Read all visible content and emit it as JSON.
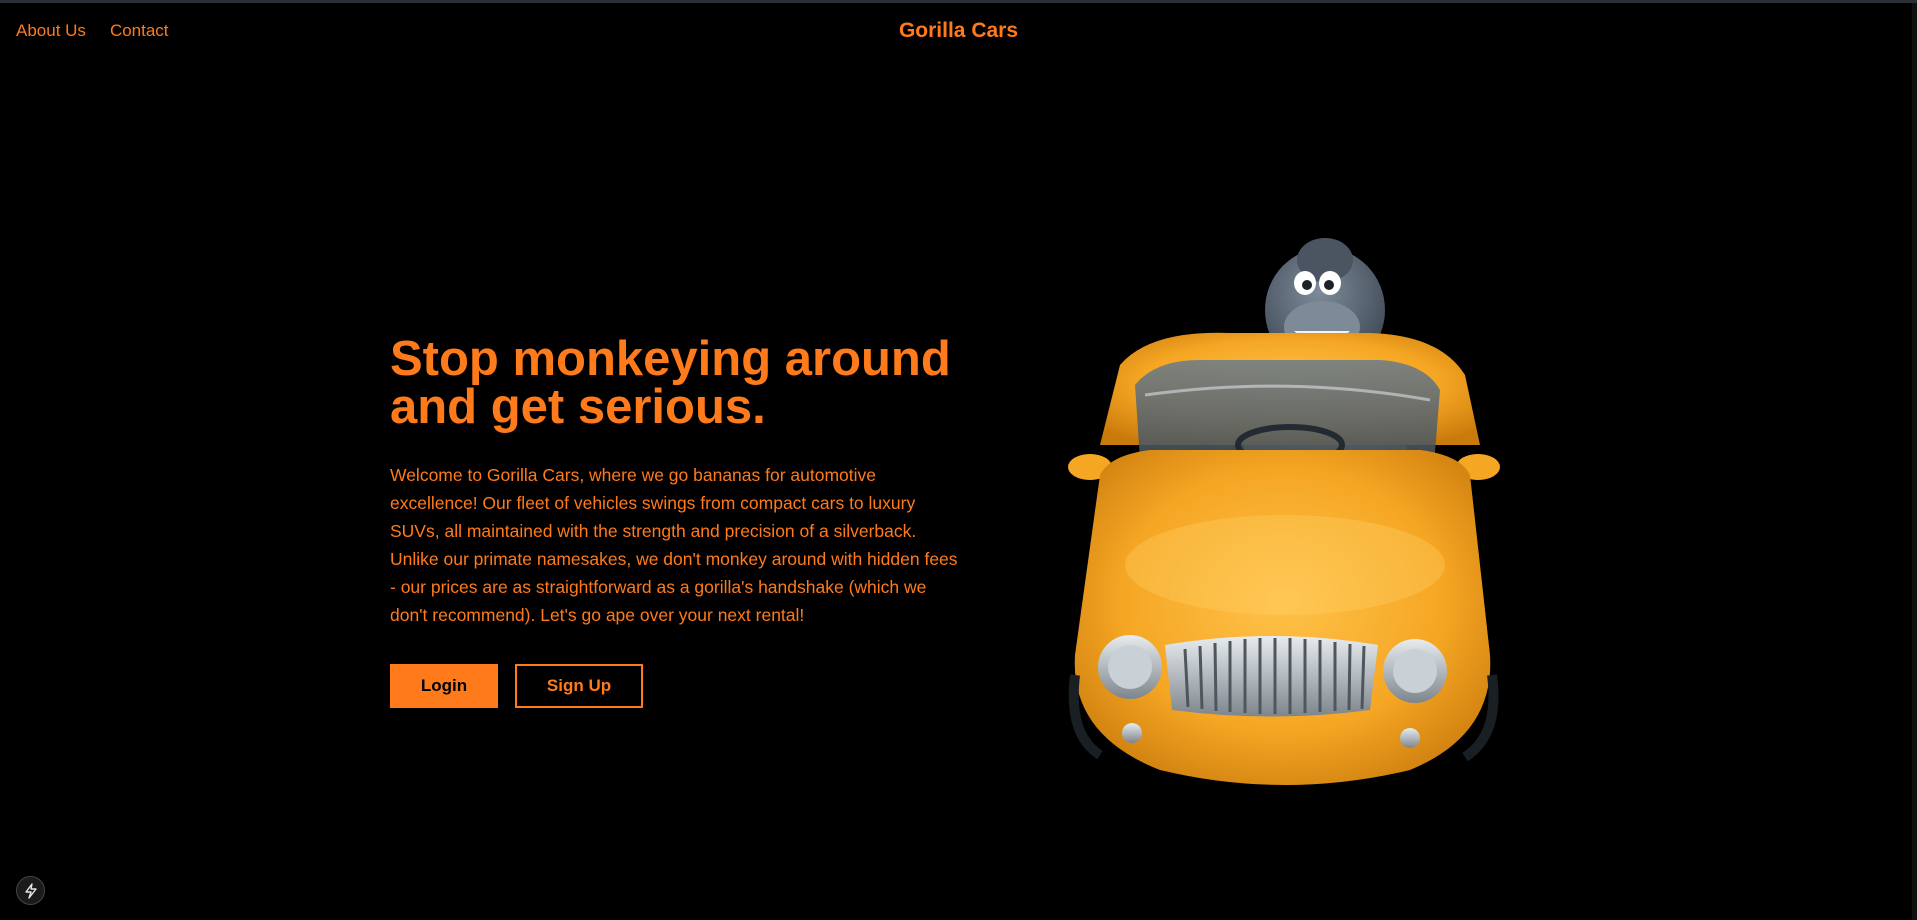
{
  "nav": {
    "about_label": "About Us",
    "contact_label": "Contact"
  },
  "brand": {
    "name": "Gorilla Cars"
  },
  "hero": {
    "headline": "Stop monkeying around and get serious.",
    "description": "Welcome to Gorilla Cars, where we go bananas for automotive excellence! Our fleet of vehicles swings from compact cars to luxury SUVs, all maintained with the strength and precision of a silverback. Unlike our primate namesakes, we don't monkey around with hidden fees - our prices are as straightforward as a gorilla's handshake (which we don't recommend). Let's go ape over your next rental!",
    "login_label": "Login",
    "signup_label": "Sign Up",
    "image_icon": "gorilla-driving-car-illustration"
  },
  "dev_badge": {
    "icon": "lightning-bolt-icon"
  },
  "colors": {
    "accent": "#ff7a1a",
    "background": "#000000",
    "car_yellow": "#f5a623",
    "gorilla_gray": "#5f6b78"
  }
}
